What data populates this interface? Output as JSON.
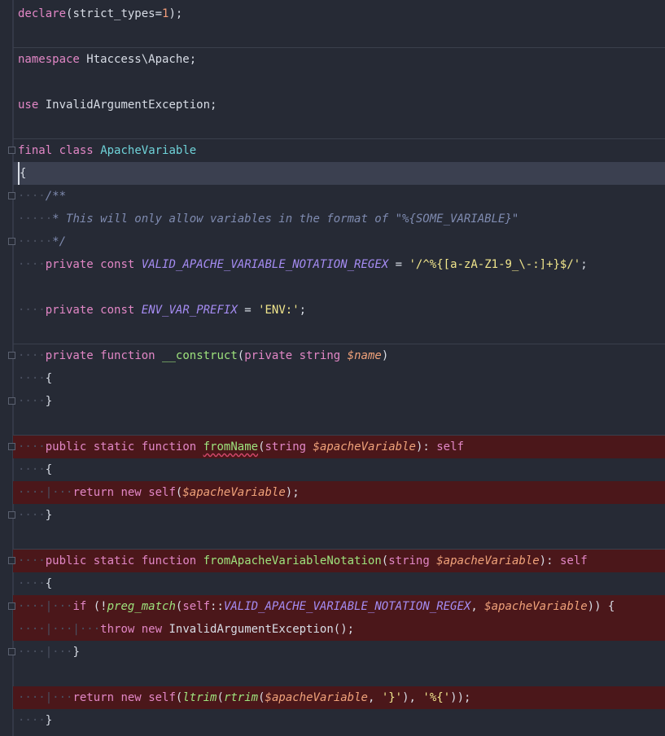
{
  "file": {
    "language": "PHP",
    "lines": {
      "l1": [
        [
          "kw",
          "declare"
        ],
        [
          "pl",
          "(strict_types="
        ],
        [
          "num",
          "1"
        ],
        [
          "pl",
          ");"
        ]
      ],
      "l2": [
        [
          "kw",
          "namespace"
        ],
        [
          "pl",
          " Htaccess\\Apache;"
        ]
      ],
      "l3": [
        [
          "kw",
          "use"
        ],
        [
          "pl",
          " InvalidArgumentException;"
        ]
      ],
      "l4": [
        [
          "kw",
          "final"
        ],
        [
          "pl",
          " "
        ],
        [
          "kw",
          "class"
        ],
        [
          "pl",
          " "
        ],
        [
          "cls",
          "ApacheVariable"
        ]
      ],
      "l5": [
        [
          "pl",
          "{"
        ]
      ],
      "l6": [
        [
          "dots",
          "····"
        ],
        [
          "cmt",
          "/**"
        ]
      ],
      "l7": [
        [
          "dots",
          "·····"
        ],
        [
          "cmt",
          "* This will only allow variables in the format of \"%{SOME_VARIABLE}\""
        ]
      ],
      "l8": [
        [
          "dots",
          "·····"
        ],
        [
          "cmt",
          "*/"
        ]
      ],
      "l9": [
        [
          "dots",
          "····"
        ],
        [
          "kw",
          "private"
        ],
        [
          "pl",
          " "
        ],
        [
          "kw",
          "const"
        ],
        [
          "pl",
          " "
        ],
        [
          "const",
          "VALID_APACHE_VARIABLE_NOTATION_REGEX"
        ],
        [
          "pl",
          " = "
        ],
        [
          "str",
          "'/^%{[a-zA-Z1-9_\\-:]+}$/'"
        ],
        [
          "pl",
          ";"
        ]
      ],
      "l10": [
        [
          "dots",
          "····"
        ],
        [
          "kw",
          "private"
        ],
        [
          "pl",
          " "
        ],
        [
          "kw",
          "const"
        ],
        [
          "pl",
          " "
        ],
        [
          "const",
          "ENV_VAR_PREFIX"
        ],
        [
          "pl",
          " = "
        ],
        [
          "str",
          "'ENV:'"
        ],
        [
          "pl",
          ";"
        ]
      ],
      "l11": [
        [
          "dots",
          "····"
        ],
        [
          "kw",
          "private"
        ],
        [
          "pl",
          " "
        ],
        [
          "kw",
          "function"
        ],
        [
          "pl",
          " "
        ],
        [
          "fn",
          "__construct"
        ],
        [
          "pl",
          "("
        ],
        [
          "kw",
          "private"
        ],
        [
          "pl",
          " "
        ],
        [
          "kw",
          "string"
        ],
        [
          "pl",
          " "
        ],
        [
          "var",
          "$name"
        ],
        [
          "pl",
          ")"
        ]
      ],
      "l12": [
        [
          "dots",
          "····"
        ],
        [
          "pl",
          "{"
        ]
      ],
      "l13": [
        [
          "dots",
          "····"
        ],
        [
          "pl",
          "}"
        ]
      ],
      "l14": [
        [
          "dots",
          "····"
        ],
        [
          "kw",
          "public"
        ],
        [
          "pl",
          " "
        ],
        [
          "kw",
          "static"
        ],
        [
          "pl",
          " "
        ],
        [
          "kw",
          "function"
        ],
        [
          "pl",
          " "
        ],
        [
          "fnsq",
          "fromName"
        ],
        [
          "pl",
          "("
        ],
        [
          "kw",
          "string"
        ],
        [
          "pl",
          " "
        ],
        [
          "var",
          "$apacheVariable"
        ],
        [
          "pl",
          "): "
        ],
        [
          "kw",
          "self"
        ]
      ],
      "l15": [
        [
          "dots",
          "····"
        ],
        [
          "pl",
          "{"
        ]
      ],
      "l16": [
        [
          "dots",
          "····|···"
        ],
        [
          "kw",
          "return"
        ],
        [
          "pl",
          " "
        ],
        [
          "kw",
          "new"
        ],
        [
          "pl",
          " "
        ],
        [
          "kw",
          "self"
        ],
        [
          "pl",
          "("
        ],
        [
          "var",
          "$apacheVariable"
        ],
        [
          "pl",
          ");"
        ]
      ],
      "l17": [
        [
          "dots",
          "····"
        ],
        [
          "pl",
          "}"
        ]
      ],
      "l18": [
        [
          "dots",
          "····"
        ],
        [
          "kw",
          "public"
        ],
        [
          "pl",
          " "
        ],
        [
          "kw",
          "static"
        ],
        [
          "pl",
          " "
        ],
        [
          "kw",
          "function"
        ],
        [
          "pl",
          " "
        ],
        [
          "fn",
          "fromApacheVariableNotation"
        ],
        [
          "pl",
          "("
        ],
        [
          "kw",
          "string"
        ],
        [
          "pl",
          " "
        ],
        [
          "var",
          "$apacheVariable"
        ],
        [
          "pl",
          "): "
        ],
        [
          "kw",
          "self"
        ]
      ],
      "l19": [
        [
          "dots",
          "····"
        ],
        [
          "pl",
          "{"
        ]
      ],
      "l20": [
        [
          "dots",
          "····|···"
        ],
        [
          "kw",
          "if"
        ],
        [
          "pl",
          " (!"
        ],
        [
          "fni",
          "preg_match"
        ],
        [
          "pl",
          "("
        ],
        [
          "kw",
          "self"
        ],
        [
          "pl",
          "::"
        ],
        [
          "const",
          "VALID_APACHE_VARIABLE_NOTATION_REGEX"
        ],
        [
          "pl",
          ", "
        ],
        [
          "var",
          "$apacheVariable"
        ],
        [
          "pl",
          ")) {"
        ]
      ],
      "l21": [
        [
          "dots",
          "····|···|···"
        ],
        [
          "kw",
          "throw"
        ],
        [
          "pl",
          " "
        ],
        [
          "kw",
          "new"
        ],
        [
          "pl",
          " InvalidArgumentException();"
        ]
      ],
      "l22": [
        [
          "dots",
          "····|···"
        ],
        [
          "pl",
          "}"
        ]
      ],
      "l23": [
        [
          "dots",
          "····|···"
        ],
        [
          "kw",
          "return"
        ],
        [
          "pl",
          " "
        ],
        [
          "kw",
          "new"
        ],
        [
          "pl",
          " "
        ],
        [
          "kw",
          "self"
        ],
        [
          "pl",
          "("
        ],
        [
          "fni",
          "ltrim"
        ],
        [
          "pl",
          "("
        ],
        [
          "fni",
          "rtrim"
        ],
        [
          "pl",
          "("
        ],
        [
          "var",
          "$apacheVariable"
        ],
        [
          "pl",
          ", "
        ],
        [
          "str",
          "'}'"
        ],
        [
          "pl",
          "), "
        ],
        [
          "str",
          "'%{'"
        ],
        [
          "pl",
          "));"
        ]
      ],
      "l24": [
        [
          "dots",
          "····"
        ],
        [
          "pl",
          "}"
        ]
      ]
    }
  }
}
